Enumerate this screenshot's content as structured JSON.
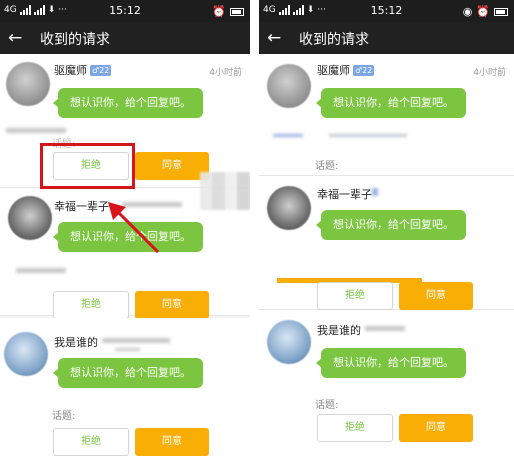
{
  "status_bar": {
    "time": "15:12",
    "signal_left": "4G",
    "signal_right": "4G"
  },
  "title_bar": {
    "back_icon": "arrow-left-icon",
    "title": "收到的请求"
  },
  "requests_left": [
    {
      "name": "驱魔师",
      "badge": "♂22",
      "time": "4小时前",
      "message": "想认识你，给个回复吧。",
      "topic": "话题:",
      "refuse": "拒绝",
      "agree": "同意"
    },
    {
      "name": "幸福一辈子",
      "message": "想认识你，给个回复吧。",
      "refuse": "拒绝",
      "agree": "同意"
    },
    {
      "name": "我是谁的",
      "message": "想认识你，给个回复吧。",
      "topic": "话题:",
      "refuse": "拒绝",
      "agree": "同意"
    }
  ],
  "requests_right": [
    {
      "name": "驱魔师",
      "badge": "♂22",
      "time": "4小时前",
      "message": "想认识你，给个回复吧。",
      "topic": "话题:"
    },
    {
      "name": "幸福一辈子",
      "message": "想认识你，给个回复吧。",
      "refuse": "拒绝",
      "agree": "同意"
    },
    {
      "name": "我是谁的",
      "message": "想认识你，给个回复吧。",
      "topic": "话题:",
      "refuse": "拒绝",
      "agree": "同意"
    }
  ],
  "annotation": {
    "highlight_color": "#d7141a",
    "arrow_color": "#d7141a"
  }
}
